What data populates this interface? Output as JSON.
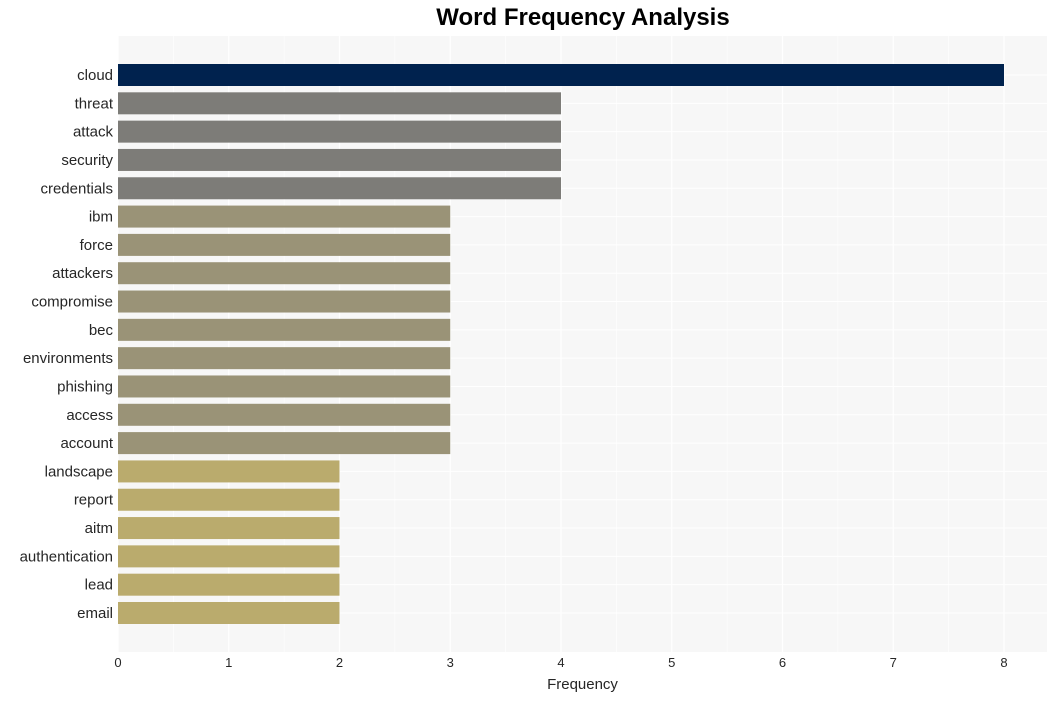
{
  "chart_data": {
    "type": "bar",
    "orientation": "horizontal",
    "title": "Word Frequency Analysis",
    "xlabel": "Frequency",
    "ylabel": "",
    "xlim": [
      0,
      8.4
    ],
    "xticks": [
      0,
      1,
      2,
      3,
      4,
      5,
      6,
      7,
      8
    ],
    "grid": true,
    "categories": [
      "cloud",
      "threat",
      "attack",
      "security",
      "credentials",
      "ibm",
      "force",
      "attackers",
      "compromise",
      "bec",
      "environments",
      "phishing",
      "access",
      "account",
      "landscape",
      "report",
      "aitm",
      "authentication",
      "lead",
      "email"
    ],
    "values": [
      8,
      4,
      4,
      4,
      4,
      3,
      3,
      3,
      3,
      3,
      3,
      3,
      3,
      3,
      2,
      2,
      2,
      2,
      2,
      2
    ],
    "colors_by_value": {
      "8": "#00224e",
      "4": "#7d7c78",
      "3": "#9a9377",
      "2": "#baab6d"
    },
    "background": "#f7f7f7"
  }
}
